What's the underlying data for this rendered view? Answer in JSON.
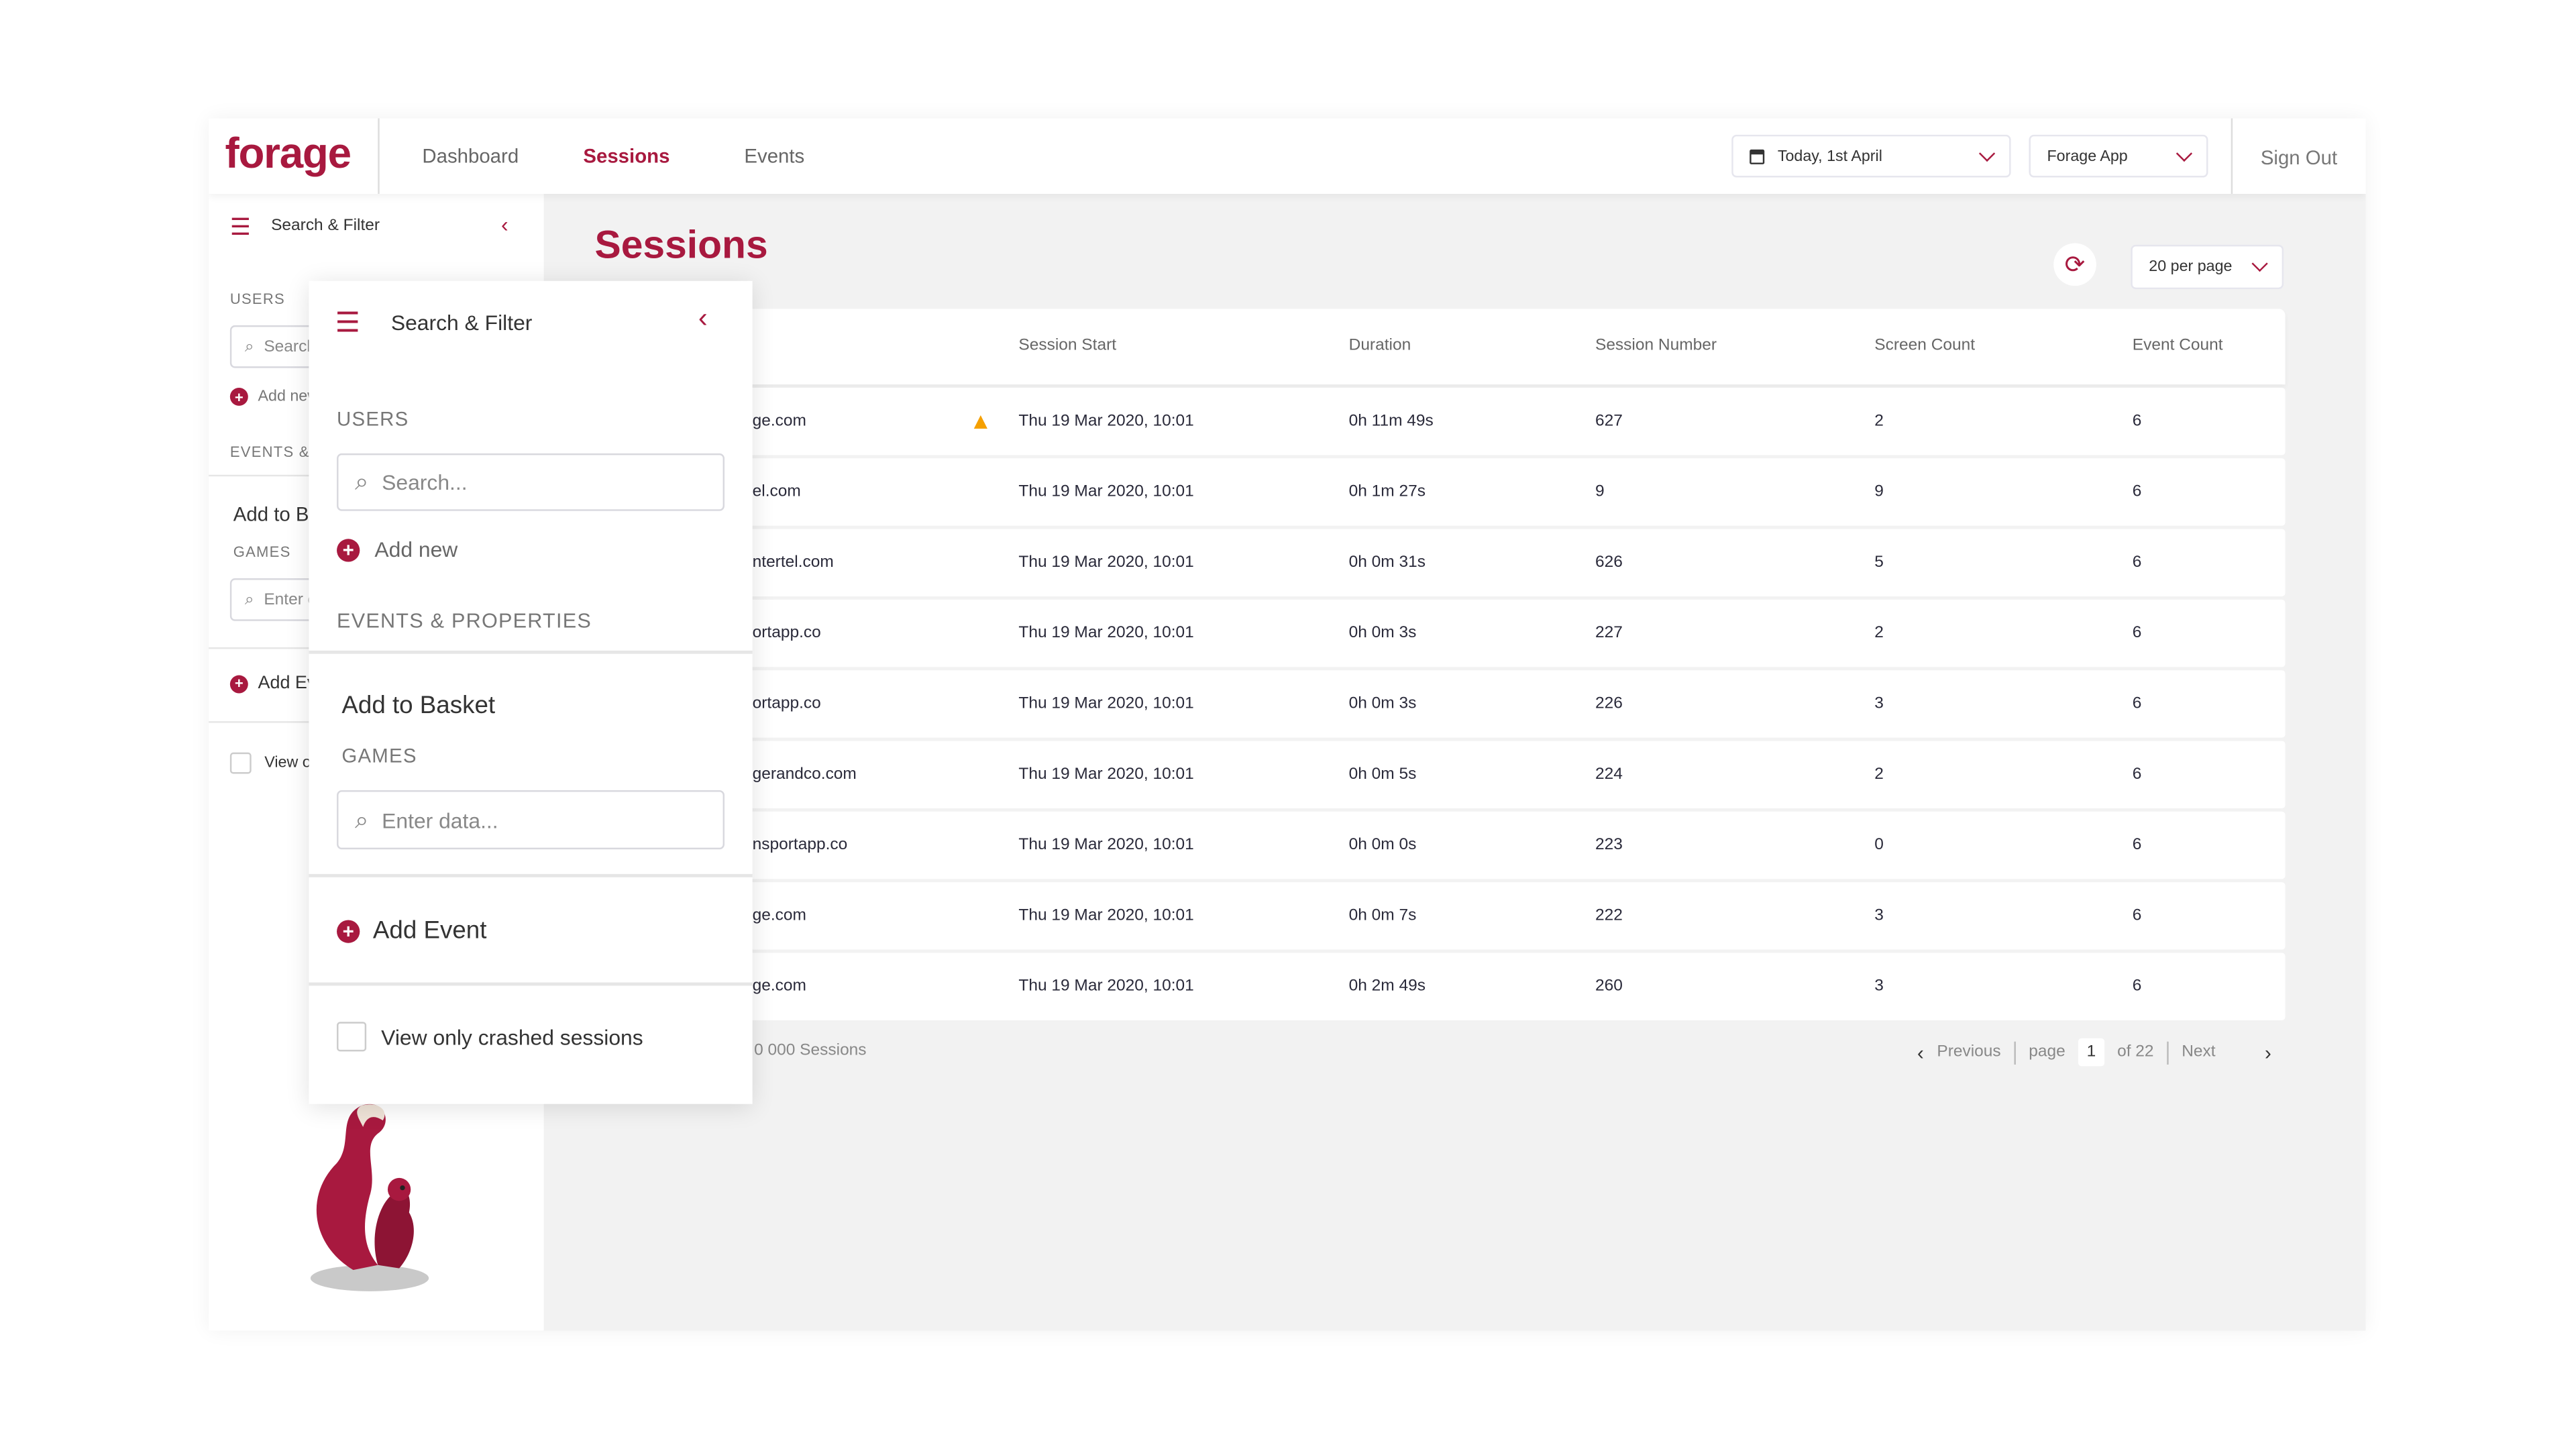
{
  "app": {
    "logo": "forage",
    "accent": "#a8193f"
  },
  "nav": {
    "items": [
      {
        "label": "Dashboard"
      },
      {
        "label": "Sessions",
        "active": true
      },
      {
        "label": "Events"
      }
    ]
  },
  "header": {
    "date_select": "Today, 1st April",
    "app_select": "Forage App",
    "sign_out": "Sign Out"
  },
  "filter": {
    "title": "Search & Filter",
    "users_label": "USERS",
    "users_placeholder": "Search...",
    "add_new": "Add new",
    "events_label": "EVENTS & PROPERTIES",
    "event_name": "Add to Basket",
    "property_label": "GAMES",
    "property_placeholder": "Enter data...",
    "add_event": "Add Event",
    "crashed_only": "View only crashed sessions",
    "crashed_checked": false
  },
  "main": {
    "title": "Sessions",
    "per_page": "20 per page",
    "columns": [
      "Session Start",
      "Duration",
      "Session Number",
      "Screen Count",
      "Event Count"
    ],
    "rows": [
      {
        "user": "ge.com",
        "warning": true,
        "start": "Thu 19 Mar 2020, 10:01",
        "duration": "0h 11m 49s",
        "number": "627",
        "screens": "2",
        "events": "6"
      },
      {
        "user": "el.com",
        "warning": false,
        "start": "Thu 19 Mar 2020, 10:01",
        "duration": "0h 1m 27s",
        "number": "9",
        "screens": "9",
        "events": "6"
      },
      {
        "user": "ntertel.com",
        "warning": false,
        "start": "Thu 19 Mar 2020, 10:01",
        "duration": "0h 0m 31s",
        "number": "626",
        "screens": "5",
        "events": "6"
      },
      {
        "user": "ortapp.co",
        "warning": false,
        "start": "Thu 19 Mar 2020, 10:01",
        "duration": "0h 0m 3s",
        "number": "227",
        "screens": "2",
        "events": "6"
      },
      {
        "user": "ortapp.co",
        "warning": false,
        "start": "Thu 19 Mar 2020, 10:01",
        "duration": "0h 0m 3s",
        "number": "226",
        "screens": "3",
        "events": "6"
      },
      {
        "user": "gerandco.com",
        "warning": false,
        "start": "Thu 19 Mar 2020, 10:01",
        "duration": "0h 0m 5s",
        "number": "224",
        "screens": "2",
        "events": "6"
      },
      {
        "user": "nsportapp.co",
        "warning": false,
        "start": "Thu 19 Mar 2020, 10:01",
        "duration": "0h 0m 0s",
        "number": "223",
        "screens": "0",
        "events": "6"
      },
      {
        "user": "ge.com",
        "warning": false,
        "start": "Thu 19 Mar 2020, 10:01",
        "duration": "0h 0m 7s",
        "number": "222",
        "screens": "3",
        "events": "6"
      },
      {
        "user": "ge.com",
        "warning": false,
        "start": "Thu 19 Mar 2020, 10:01",
        "duration": "0h 2m 49s",
        "number": "260",
        "screens": "3",
        "events": "6"
      }
    ],
    "total": "0 000 Sessions",
    "pagination": {
      "previous": "Previous",
      "page_label": "page",
      "page": "1",
      "of": "of 22",
      "next": "Next"
    }
  }
}
